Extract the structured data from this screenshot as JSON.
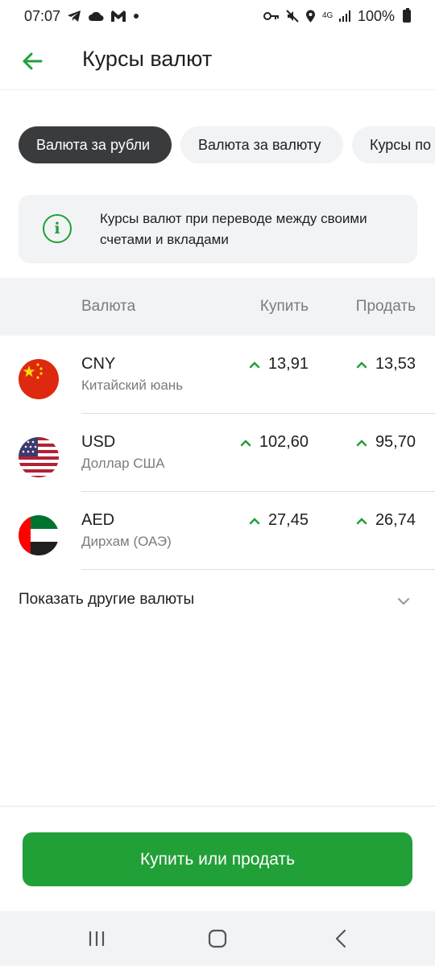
{
  "status_bar": {
    "time": "07:07",
    "left_icons": [
      "telegram-icon",
      "cloud-icon",
      "gmail-icon",
      "dot-icon"
    ],
    "right_icons": [
      "key-icon",
      "mute-icon",
      "location-icon",
      "network-4g-icon",
      "signal-icon",
      "battery-icon"
    ],
    "network": "4G",
    "battery": "100%"
  },
  "app_bar": {
    "title": "Курсы валют",
    "back_icon": "arrow-left-icon"
  },
  "chips": [
    {
      "label": "Валюта за рубли",
      "active": true
    },
    {
      "label": "Валюта за валюту",
      "active": false
    },
    {
      "label": "Курсы по",
      "active": false
    }
  ],
  "info": {
    "icon": "info-icon",
    "text": "Курсы валют при переводе между своими счетами и вкладами"
  },
  "table": {
    "headers": {
      "currency": "Валюта",
      "buy": "Купить",
      "sell": "Продать"
    },
    "rows": [
      {
        "code": "CNY",
        "name": "Китайский юань",
        "buy": "13,91",
        "sell": "13,53",
        "flag": "china-flag-icon",
        "trend": "up"
      },
      {
        "code": "USD",
        "name": "Доллар США",
        "buy": "102,60",
        "sell": "95,70",
        "flag": "usa-flag-icon",
        "trend": "up"
      },
      {
        "code": "AED",
        "name": "Дирхам (ОАЭ)",
        "buy": "27,45",
        "sell": "26,74",
        "flag": "uae-flag-icon",
        "trend": "up"
      }
    ]
  },
  "show_more": {
    "label": "Показать другие валюты",
    "icon": "chevron-down-icon"
  },
  "primary_button": {
    "label": "Купить или продать"
  },
  "colors": {
    "accent": "#21a038",
    "chip_active": "#3a3b3d",
    "surface": "#f2f3f5",
    "text_secondary": "#7a7b80"
  },
  "nav_bar": {
    "buttons": [
      "recents-icon",
      "home-icon",
      "back-icon"
    ]
  }
}
